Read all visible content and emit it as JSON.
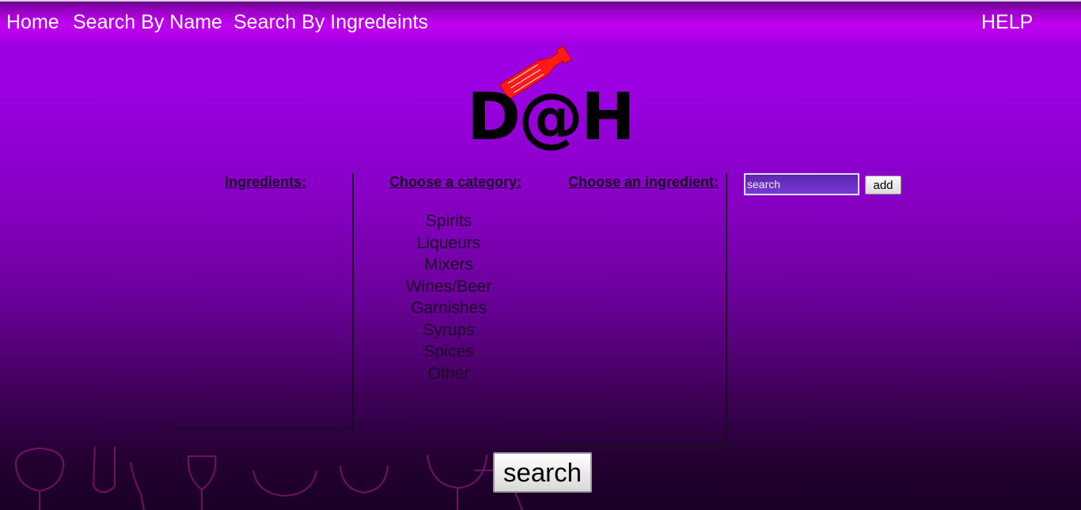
{
  "nav": {
    "home": "Home",
    "search_by_name": "Search By Name",
    "search_by_ingredients": "Search By Ingredeints",
    "help": "HELP"
  },
  "logo": {
    "text": "D@H",
    "icon": "bottle-icon",
    "bottle_color": "#ff1a1a"
  },
  "columns": {
    "ingredients_header": "Ingredients:",
    "category_header": "Choose a category:",
    "ingredient_header": "Choose an ingredient:"
  },
  "categories": [
    "Spirits",
    "Liqueurs",
    "Mixers",
    "Wines/Beer",
    "Garnishes",
    "Syrups",
    "Spices",
    "Other"
  ],
  "search_box": {
    "value": "search",
    "add_label": "add"
  },
  "search_button": {
    "label": "search"
  },
  "colors": {
    "background_top": "#a000e8",
    "background_bottom": "#1a0024",
    "nav_text": "#ffffff"
  }
}
